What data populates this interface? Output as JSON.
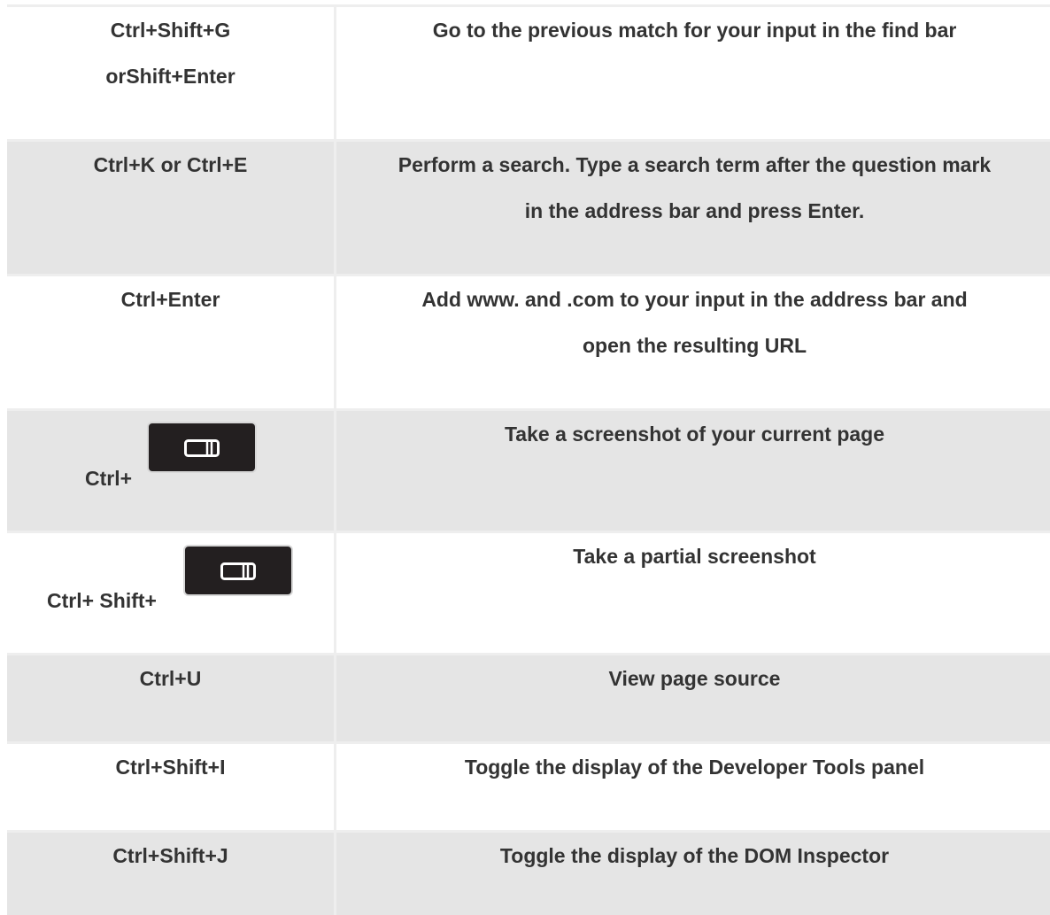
{
  "shortcuts": [
    {
      "keys_lines": [
        "Ctrl+Shift+G",
        "orShift+Enter"
      ],
      "description_lines": [
        "Go to the previous match for your input in the find bar"
      ]
    },
    {
      "keys_lines": [
        "Ctrl+K or Ctrl+E"
      ],
      "description_lines": [
        "Perform a search. Type a search term after the question mark",
        "in the address bar and press Enter."
      ]
    },
    {
      "keys_lines": [
        "Ctrl+Enter"
      ],
      "description_lines": [
        "Add www. and .com to your input in the address bar and",
        "open the resulting URL"
      ]
    },
    {
      "keys_prefix": "Ctrl+",
      "key_icon": "screenshot-key-icon",
      "description_lines": [
        "Take a screenshot of your current page"
      ]
    },
    {
      "keys_prefix": "Ctrl+ Shift+",
      "key_icon": "screenshot-key-icon",
      "description_lines": [
        "Take a partial screenshot"
      ]
    },
    {
      "keys_lines": [
        "Ctrl+U"
      ],
      "description_lines": [
        "View page source"
      ]
    },
    {
      "keys_lines": [
        "Ctrl+Shift+I"
      ],
      "description_lines": [
        "Toggle the display of the Developer Tools panel"
      ]
    },
    {
      "keys_lines": [
        "Ctrl+Shift+J"
      ],
      "description_lines": [
        "Toggle the display of the DOM Inspector"
      ]
    }
  ],
  "colors": {
    "row_shaded": "#e5e5e5",
    "row_plain": "#ffffff",
    "border": "#eeeeee",
    "text": "#333333",
    "key_cap": "#231f20"
  }
}
